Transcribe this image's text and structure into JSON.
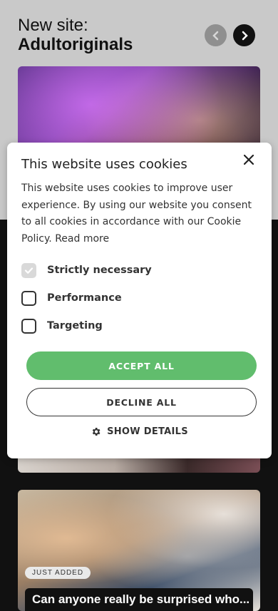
{
  "header": {
    "line1": "New site:",
    "line2": "Adultoriginals"
  },
  "icons": {
    "prev": "chevron-left-icon",
    "next": "chevron-right-icon",
    "close": "close-icon",
    "gear": "gear-icon",
    "check": "check-icon"
  },
  "cards": {
    "second": {
      "badge": "JUST ADDED",
      "title": "Can anyone really be surprised who..."
    }
  },
  "cookie_dialog": {
    "title": "This website uses cookies",
    "body": "This website uses cookies to improve user experience. By using our website you consent to all cookies in accordance with our Cookie Policy.",
    "read_more": "Read more",
    "options": [
      {
        "label": "Strictly necessary",
        "checked": true,
        "disabled": true
      },
      {
        "label": "Performance",
        "checked": false
      },
      {
        "label": "Targeting",
        "checked": false
      }
    ],
    "accept_label": "ACCEPT ALL",
    "decline_label": "DECLINE ALL",
    "details_label": "SHOW DETAILS"
  },
  "colors": {
    "accept_green": "#61bd6d",
    "page_dark": "#111111",
    "top_gray": "#c9c9c9"
  }
}
